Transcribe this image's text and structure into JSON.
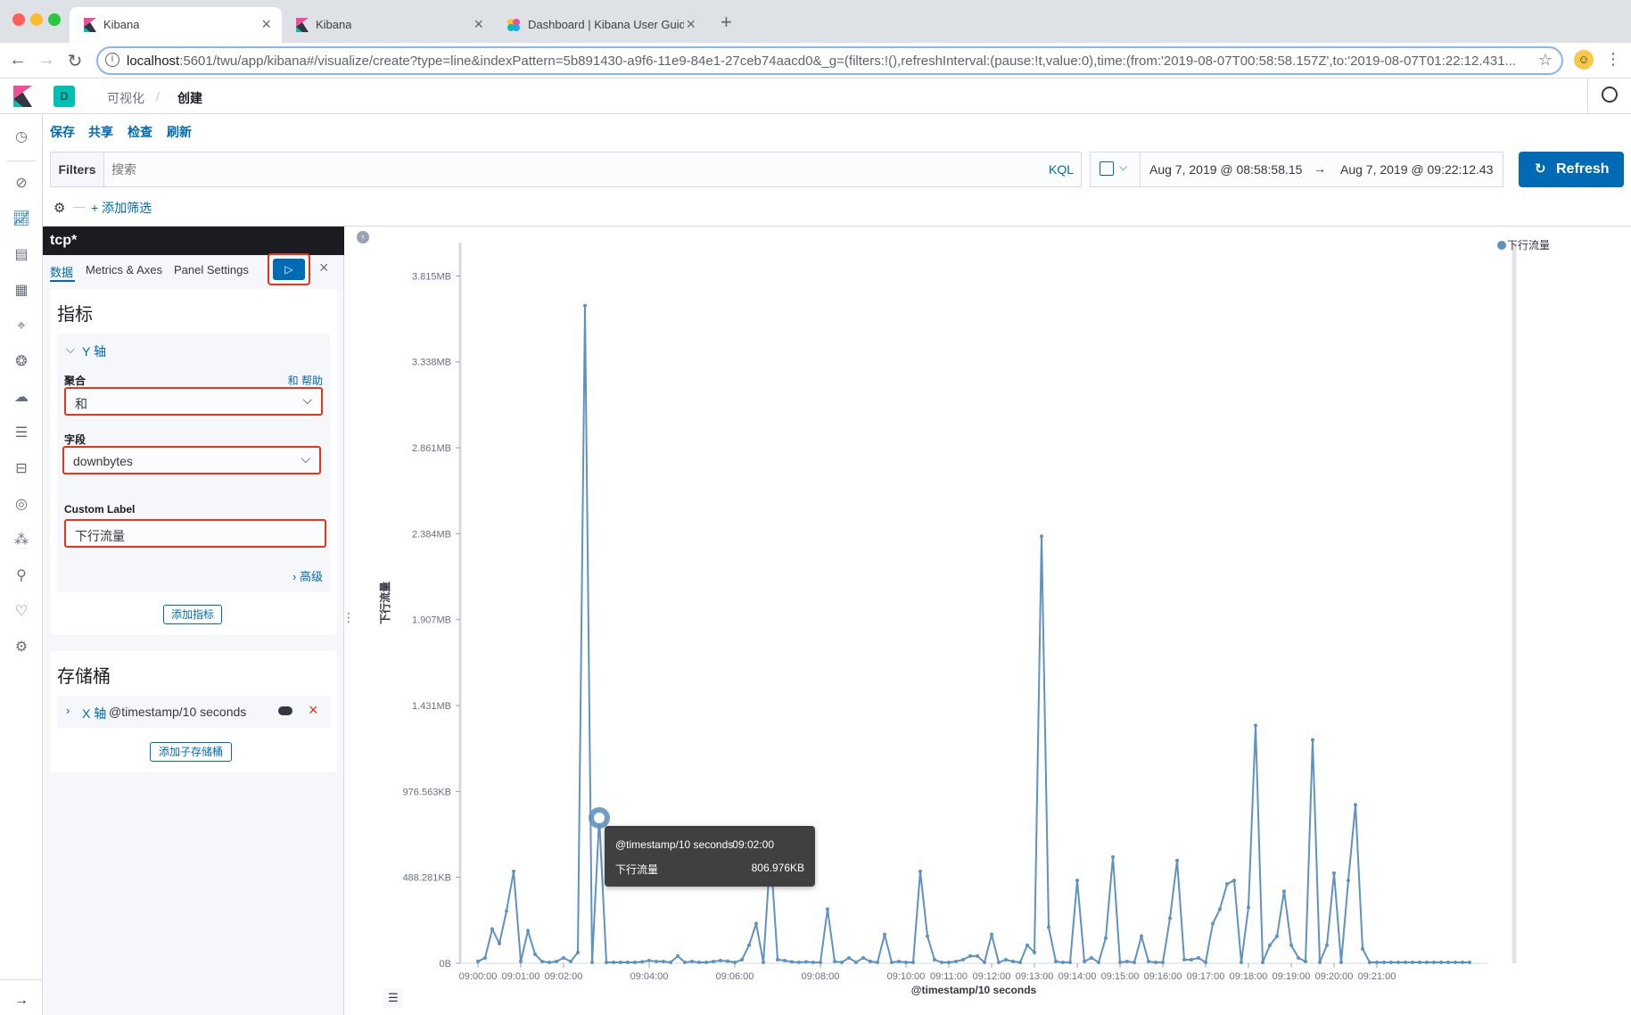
{
  "browser": {
    "tabs": [
      {
        "title": "Kibana",
        "active": true
      },
      {
        "title": "Kibana",
        "active": false
      },
      {
        "title": "Dashboard | Kibana User Guide",
        "active": false
      }
    ],
    "new_tab": "+",
    "url_host": "localhost",
    "url_rest": ":5601/twu/app/kibana#/visualize/create?type=line&indexPattern=5b891430-a9f6-11e9-84e1-27ceb74aacd0&_g=(filters:!(),refreshInterval:(pause:!t,value:0),time:(from:'2019-08-07T00:58:58.157Z',to:'2019-08-07T01:22:12.431..."
  },
  "header": {
    "space_letter": "D",
    "breadcrumb_1": "可视化",
    "breadcrumb_sep": "/",
    "breadcrumb_2": "创建"
  },
  "top_menu": {
    "save": "保存",
    "share": "共享",
    "inspect": "检查",
    "refresh": "刷新"
  },
  "query": {
    "filters_label": "Filters",
    "search_placeholder": "搜索",
    "kql": "KQL",
    "add_filter": "+ 添加筛选"
  },
  "time": {
    "from": "Aug 7, 2019 @ 08:58:58.15",
    "arrow": "→",
    "to": "Aug 7, 2019 @ 09:22:12.43",
    "refresh_label": "Refresh"
  },
  "editor": {
    "index_pattern": "tcp*",
    "tabs": [
      "数据",
      "Metrics & Axes",
      "Panel Settings"
    ],
    "metrics_title": "指标",
    "y_axis_label": "Y 轴",
    "aggregation_label": "聚合",
    "aggregation_help": "和 帮助",
    "aggregation_value": "和",
    "field_label": "字段",
    "field_value": "downbytes",
    "custom_label_label": "Custom Label",
    "custom_label_value": "下行流量",
    "advanced": "高级",
    "add_metric": "添加指标",
    "buckets_title": "存储桶",
    "x_axis_label": "X 轴",
    "x_axis_value": "@timestamp/10 seconds",
    "add_sub_bucket": "添加子存储桶"
  },
  "tooltip": {
    "key1": "@timestamp/10 seconds",
    "val1": "09:02:00",
    "key2": "下行流量",
    "val2": "806.976KB"
  },
  "colors": {
    "series": "#6092c0",
    "accent": "#006bb4",
    "highlight": "#e5351c"
  },
  "chart_data": {
    "type": "line",
    "xlabel": "@timestamp/10 seconds",
    "ylabel": "下行流量",
    "legend": [
      "下行流量"
    ],
    "legend_position": "top-right",
    "y_tick_labels": [
      "0B",
      "488.281KB",
      "976.563KB",
      "1.431MB",
      "1.907MB",
      "2.384MB",
      "2.861MB",
      "3.338MB",
      "3.815MB"
    ],
    "ylim_bytes": [
      0,
      4000000
    ],
    "x_tick_labels": [
      "09:00:00",
      "09:01:00",
      "09:02:00",
      "09:04:00",
      "09:06:00",
      "09:08:00",
      "09:10:00",
      "09:11:00",
      "09:12:00",
      "09:13:00",
      "09:14:00",
      "09:15:00",
      "09:16:00",
      "09:17:00",
      "09:18:00",
      "09:19:00",
      "09:20:00",
      "09:21:00"
    ],
    "series": [
      {
        "name": "下行流量",
        "x_seconds": [
          0,
          10,
          20,
          30,
          40,
          50,
          60,
          70,
          80,
          90,
          100,
          110,
          120,
          130,
          140,
          150,
          160,
          170,
          180,
          190,
          200,
          210,
          220,
          230,
          240,
          250,
          260,
          270,
          280,
          290,
          300,
          310,
          320,
          330,
          340,
          350,
          360,
          370,
          380,
          390,
          400,
          410,
          420,
          430,
          440,
          450,
          460,
          470,
          480,
          490,
          500,
          510,
          520,
          530,
          540,
          550,
          560,
          570,
          580,
          590,
          600,
          610,
          620,
          630,
          640,
          650,
          660,
          670,
          680,
          690,
          700,
          710,
          720,
          730,
          740,
          750,
          760,
          770,
          780,
          790,
          800,
          810,
          820,
          830,
          840,
          850,
          860,
          870,
          880,
          890,
          900,
          910,
          920,
          930,
          940,
          950,
          960,
          970,
          980,
          990,
          1000,
          1010,
          1020,
          1030,
          1040,
          1050,
          1060,
          1070,
          1080,
          1090,
          1100,
          1110,
          1120,
          1130,
          1140,
          1150,
          1160,
          1170,
          1180,
          1190,
          1200,
          1210,
          1220,
          1230,
          1240,
          1250,
          1260,
          1270,
          1280,
          1290,
          1300,
          1310,
          1320,
          1330,
          1340,
          1350,
          1360,
          1370,
          1380,
          1390
        ],
        "values_bytes": [
          10000,
          30000,
          190000,
          110000,
          290000,
          510000,
          10000,
          180000,
          50000,
          10000,
          5000,
          10000,
          30000,
          10000,
          60000,
          3650000,
          5000,
          806976,
          5000,
          5000,
          5000,
          5000,
          5000,
          8000,
          15000,
          10000,
          10000,
          5000,
          40000,
          5000,
          10000,
          5000,
          5000,
          10000,
          15000,
          12000,
          5000,
          20000,
          100000,
          220000,
          5000,
          620000,
          20000,
          15000,
          8000,
          5000,
          8000,
          5000,
          5000,
          300000,
          10000,
          5000,
          30000,
          5000,
          30000,
          10000,
          5000,
          160000,
          5000,
          10000,
          5000,
          5000,
          510000,
          150000,
          20000,
          5000,
          5000,
          10000,
          20000,
          40000,
          40000,
          5000,
          160000,
          5000,
          20000,
          10000,
          5000,
          100000,
          60000,
          2370000,
          200000,
          10000,
          5000,
          5000,
          460000,
          10000,
          30000,
          5000,
          140000,
          590000,
          5000,
          10000,
          5000,
          150000,
          10000,
          5000,
          5000,
          250000,
          570000,
          20000,
          20000,
          30000,
          5000,
          220000,
          300000,
          440000,
          460000,
          5000,
          310000,
          1320000,
          5000,
          100000,
          150000,
          400000,
          100000,
          30000,
          10000,
          1240000,
          5000,
          100000,
          500000,
          5000,
          460000,
          880000,
          80000,
          5000,
          5000,
          5000,
          5000,
          5000,
          5000,
          5000,
          5000,
          5000,
          5000,
          5000,
          5000,
          5000,
          5000,
          5000
        ]
      }
    ]
  }
}
